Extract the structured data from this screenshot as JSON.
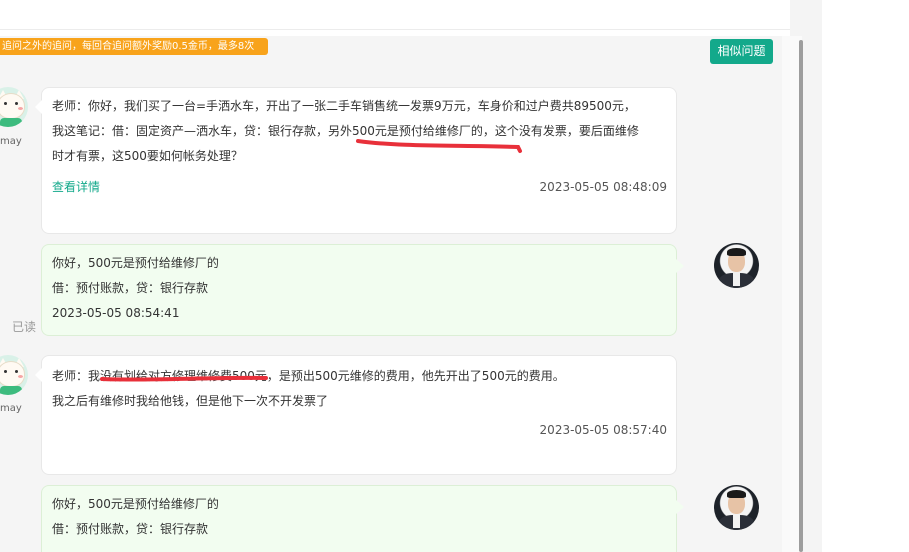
{
  "notice": {
    "text": "追问之外的追问，每回合追问额外奖励0.5金币，最多8次"
  },
  "similar_button": {
    "label": "相似问题"
  },
  "colors": {
    "accent": "#13a98b",
    "notice_bg": "#f8a31b",
    "highlight_ink": "#e8303a",
    "reply_bg": "#f2fdf0"
  },
  "messages": [
    {
      "author_name": "may",
      "lines": [
        "老师：你好，我们买了一台=手洒水车，开出了一张二手车销售统一发票9万元，车身价和过户费共89500元，",
        "我这笔记：借：固定资产—洒水车，贷：银行存款，另外500元是预付给维修厂的，这个没有发票，要后面维修",
        "时才有票，这500要如何帐务处理？"
      ],
      "link_label": "查看详情",
      "timestamp": "2023-05-05 08:48:09"
    },
    {
      "lines": [
        "你好，500元是预付给维修厂的",
        "借：预付账款，贷：银行存款",
        "2023-05-05 08:54:41"
      ],
      "read_label": "已读"
    },
    {
      "author_name": "may",
      "lines": [
        "老师：我没有划给对方修理维修费500元，是预出500元维修的费用，他先开出了500元的费用。",
        "我之后有维修时我给他钱，但是他下一次不开发票了"
      ],
      "timestamp": "2023-05-05 08:57:40"
    },
    {
      "lines": [
        "你好，500元是预付给维修厂的",
        "借：预付账款，贷：银行存款"
      ]
    }
  ]
}
